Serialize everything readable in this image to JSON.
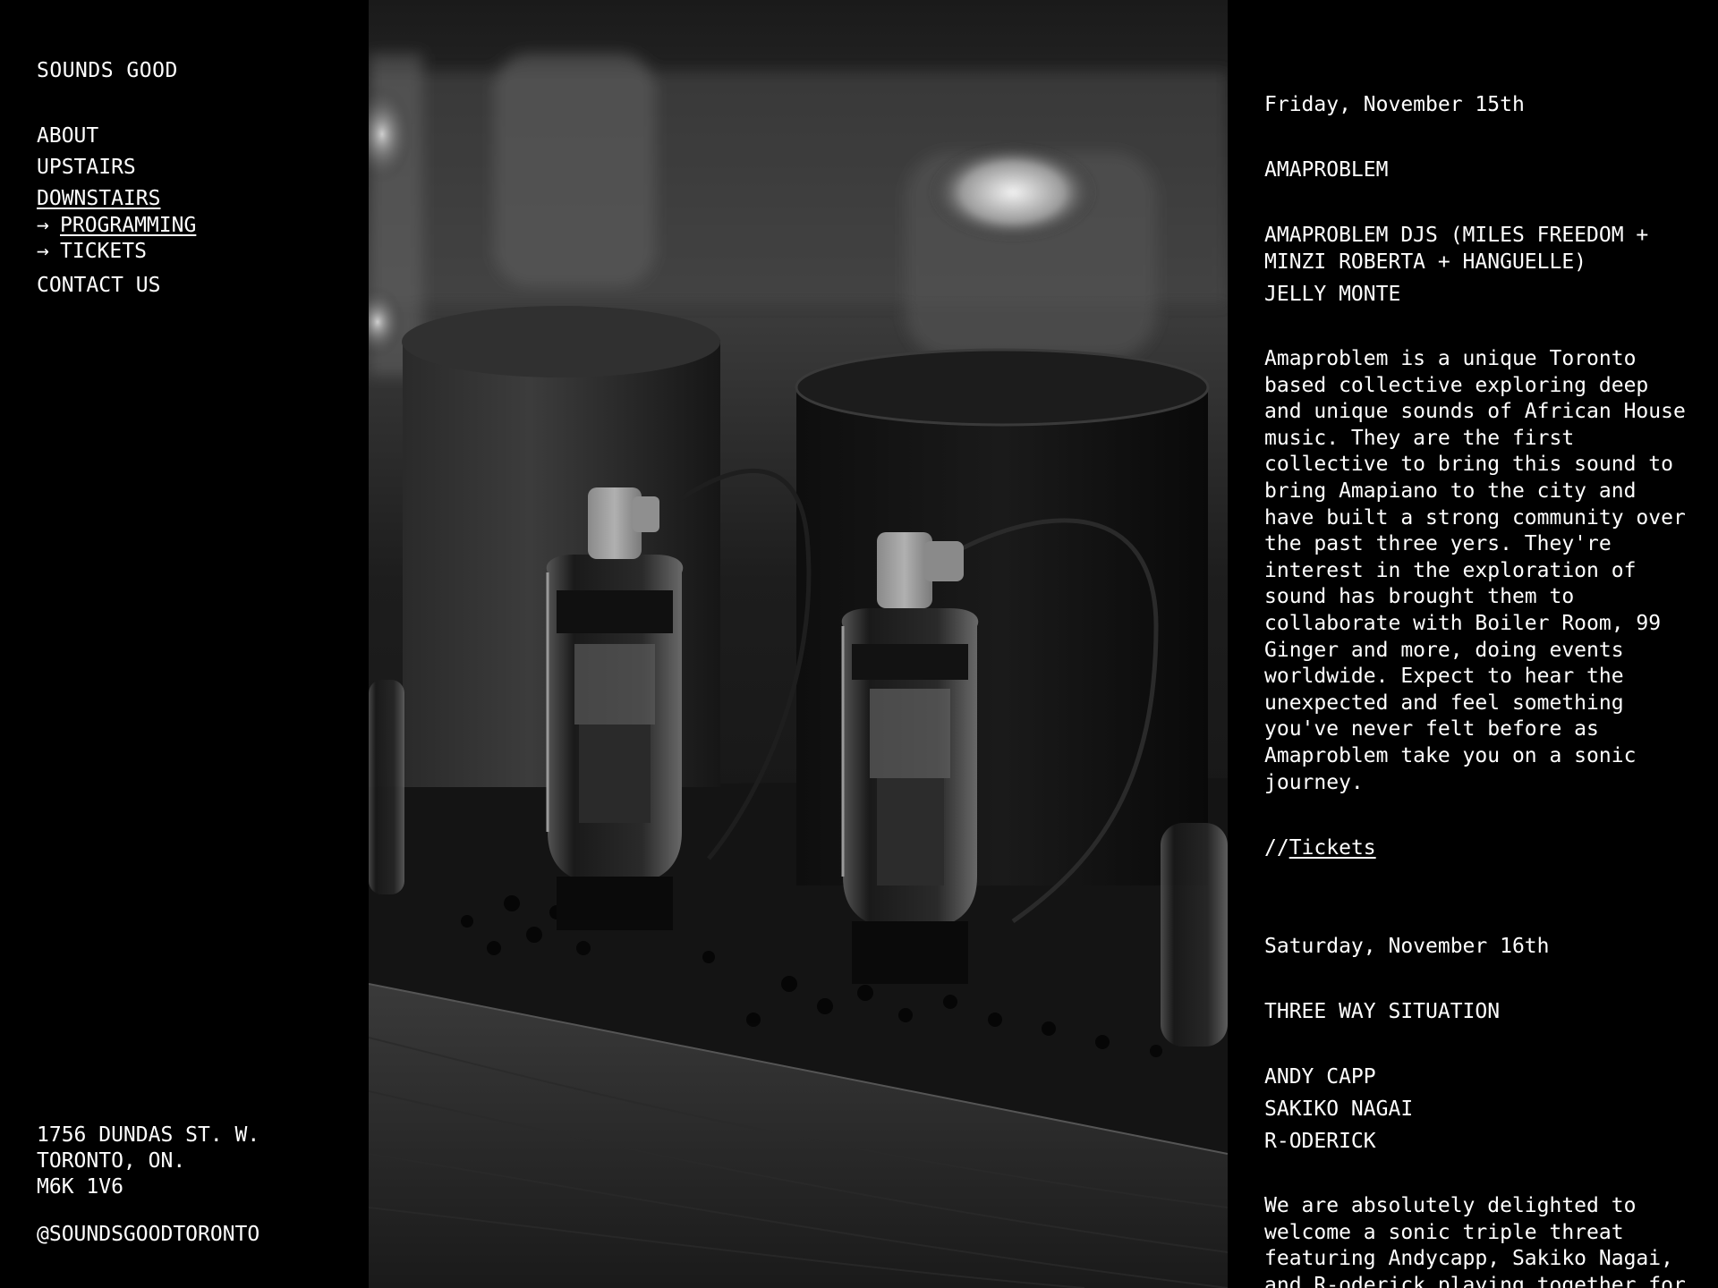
{
  "site": {
    "brand": "SOUNDS GOOD"
  },
  "nav": {
    "about": "ABOUT",
    "upstairs": "UPSTAIRS",
    "downstairs": "DOWNSTAIRS",
    "programming": "PROGRAMMING",
    "tickets": "TICKETS",
    "contact": "CONTACT US",
    "arrow": "→"
  },
  "footer": {
    "address_line1": "1756 DUNDAS ST. W.",
    "address_line2": "TORONTO, ON.",
    "address_line3": "M6K 1V6",
    "social": "@SOUNDSGOODTORONTO"
  },
  "events": [
    {
      "date": "Friday, November 15th",
      "title": "AMAPROBLEM",
      "artists": [
        "AMAPROBLEM DJS (MILES FREEDOM + MINZI ROBERTA + HANGUELLE)",
        "JELLY MONTE"
      ],
      "description": "Amaproblem is a unique Toronto based collective exploring deep and unique sounds of African House music. They are the first collective to bring this sound to bring Amapiano to the city and have built a strong community over the past three yers. They're interest in the exploration of sound has brought them to collaborate with Boiler Room, 99 Ginger and more, doing events worldwide. Expect to hear the unexpected and feel something you've never felt before as Amaproblem take you on a sonic journey.",
      "tickets_prefix": "//",
      "tickets_label": "Tickets"
    },
    {
      "date": "Saturday, November 16th",
      "title": "THREE WAY SITUATION",
      "artists": [
        "ANDY CAPP",
        "SAKIKO NAGAI",
        "R-ODERICK"
      ],
      "description": "We are absolutely delighted to welcome a sonic triple threat featuring Andycapp, Sakiko Nagai, and R-oderick playing together for"
    }
  ]
}
